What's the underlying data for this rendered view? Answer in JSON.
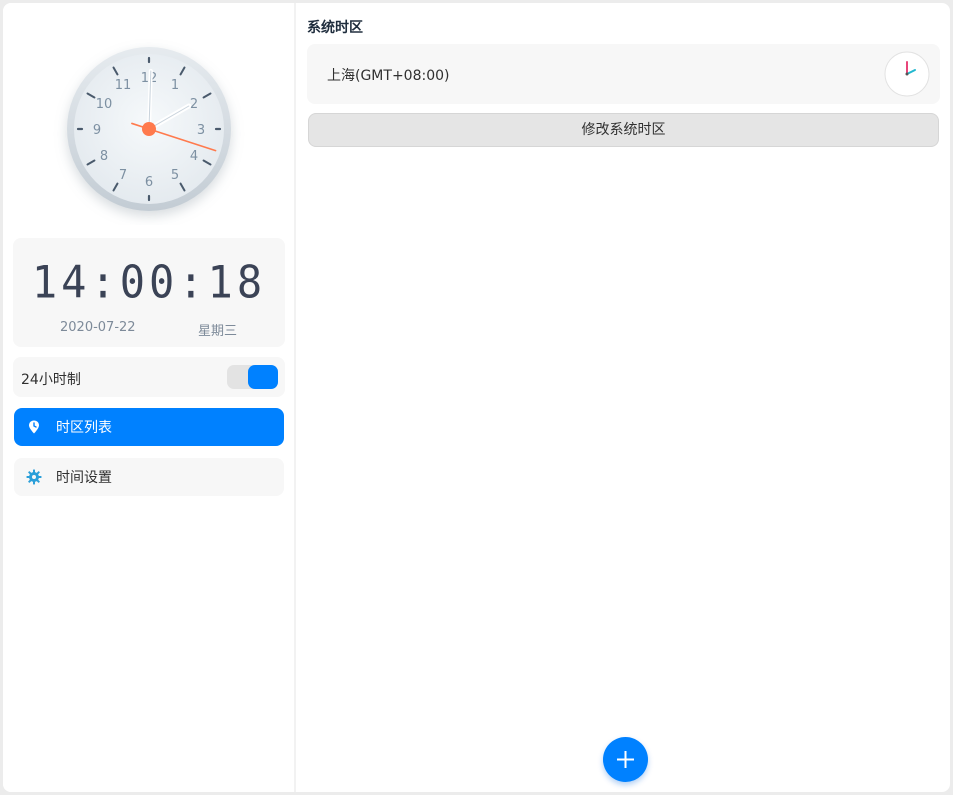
{
  "sidebar": {
    "clock": {
      "numerals": [
        "12",
        "1",
        "2",
        "3",
        "4",
        "5",
        "6",
        "7",
        "8",
        "9",
        "10",
        "11"
      ],
      "hour": 14,
      "minute": 0,
      "second": 18
    },
    "digital": {
      "time": "14:00:18",
      "date": "2020-07-22",
      "weekday": "星期三"
    },
    "toggle": {
      "label": "24小时制",
      "state": "on"
    },
    "nav": [
      {
        "label": "时区列表",
        "icon": "location-pin-icon",
        "active": true
      },
      {
        "label": "时间设置",
        "icon": "gear-icon",
        "active": false
      }
    ]
  },
  "main": {
    "section_title": "系统时区",
    "timezone": {
      "name": "上海(GMT+08:00)",
      "icon": "mini-clock-icon"
    },
    "modify_button": "修改系统时区",
    "add_button_icon": "plus-icon"
  },
  "colors": {
    "accent": "#0081ff",
    "card": "#f7f7f7",
    "second_hand": "#ff7a4d"
  }
}
